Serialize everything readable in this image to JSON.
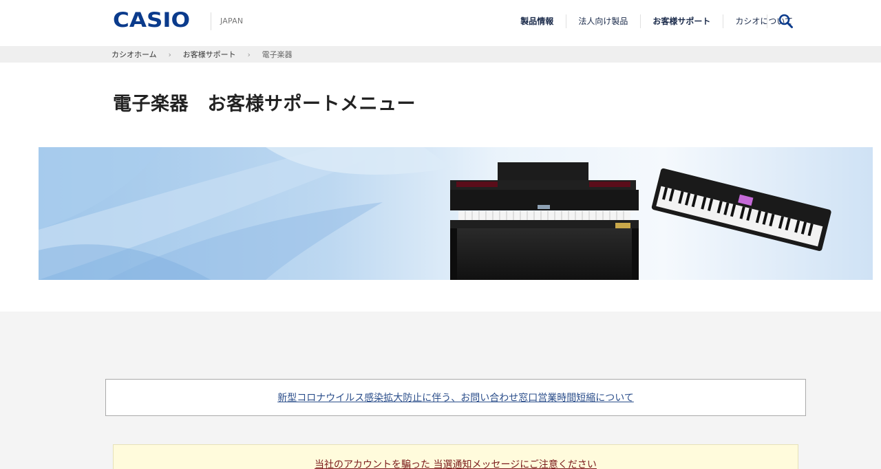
{
  "header": {
    "logo": "CASIO",
    "region": "JAPAN",
    "nav": [
      {
        "label": "製品情報"
      },
      {
        "label": "法人向け製品"
      },
      {
        "label": "お客様サポート"
      },
      {
        "label": "カシオについて"
      }
    ],
    "search_icon": "search-icon"
  },
  "breadcrumb": [
    {
      "label": "カシオホーム"
    },
    {
      "label": "お客様サポート"
    },
    {
      "label": "電子楽器"
    }
  ],
  "page": {
    "title": "電子楽器　お客様サポートメニュー"
  },
  "notices": {
    "covid": "新型コロナウイルス感染拡大防止に伴う、お問い合わせ窓口営業時間短縮について",
    "phishing": "当社のアカウントを騙った 当選通知メッセージにご注意ください"
  },
  "colors": {
    "brand": "#0b3b8c",
    "link": "#2a4d8a",
    "warning_link": "#7a1a1a",
    "warning_bg": "#fffbdc"
  }
}
